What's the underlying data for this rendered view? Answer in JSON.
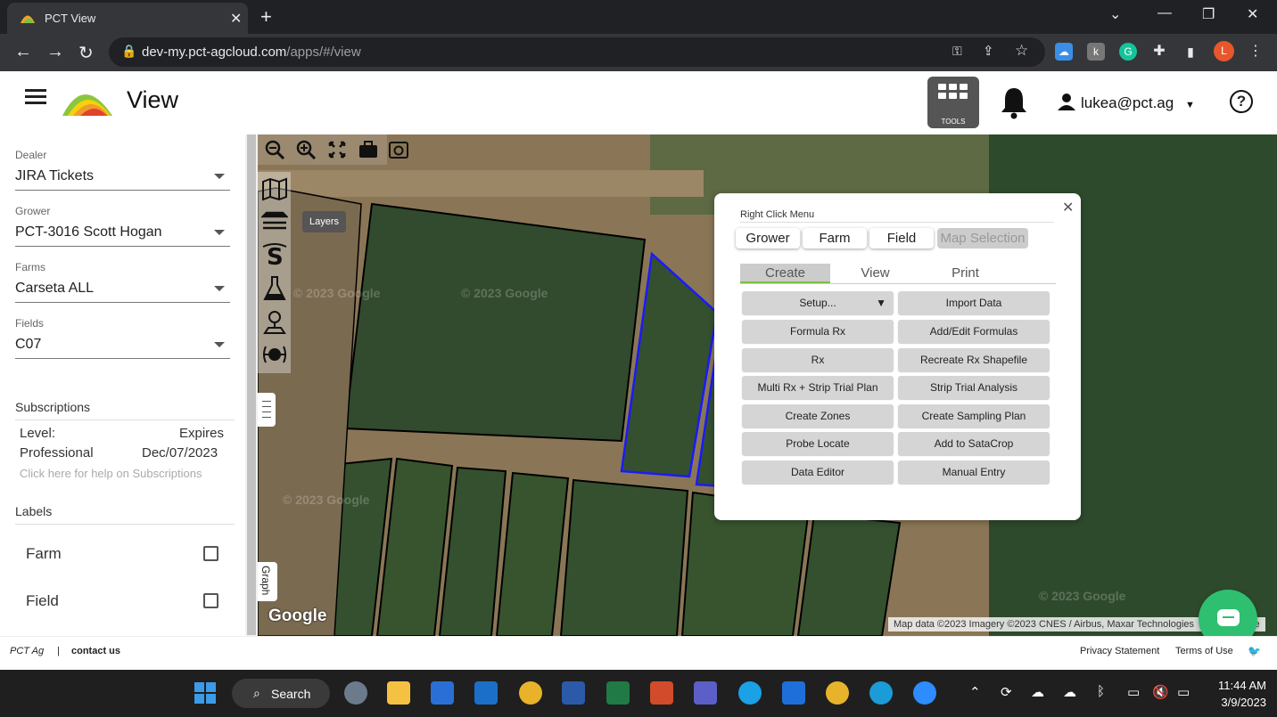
{
  "browser": {
    "tab_title": "PCT View",
    "url_host": "dev-my.pct-agcloud.com",
    "url_path": "/apps/#/view",
    "profile_initial": "L"
  },
  "header": {
    "title": "View",
    "tools_label": "TOOLS",
    "user_email": "lukea@pct.ag",
    "help_label": "?"
  },
  "sidebar": {
    "dealer": {
      "label": "Dealer",
      "value": "JIRA Tickets"
    },
    "grower": {
      "label": "Grower",
      "value": "PCT-3016 Scott Hogan"
    },
    "farms": {
      "label": "Farms",
      "value": "Carseta ALL"
    },
    "fields": {
      "label": "Fields",
      "value": "C07"
    },
    "subscriptions": {
      "heading": "Subscriptions",
      "level_label": "Level:",
      "expires_label": "Expires",
      "level_value": "Professional",
      "expires_value": "Dec/07/2023",
      "help_link": "Click here for help on Subscriptions"
    },
    "labels": {
      "heading": "Labels",
      "items": [
        {
          "label": "Farm",
          "checked": false
        },
        {
          "label": "Field",
          "checked": false
        }
      ]
    }
  },
  "map": {
    "layers_tooltip": "Layers",
    "graph_tab": "Graph",
    "google_logo": "Google",
    "watermark": "© 2023 Google",
    "attribution": "Map data ©2023 Imagery ©2023 CNES / Airbus, Maxar Technologies",
    "attribution_tail": "se"
  },
  "popup": {
    "title": "Right Click Menu",
    "scopes": [
      "Grower",
      "Farm",
      "Field",
      "Map Selection"
    ],
    "tabs": [
      "Create",
      "View",
      "Print"
    ],
    "active_tab": "Create",
    "actions_left": [
      "Setup...",
      "Formula Rx",
      "Rx",
      "Multi Rx + Strip Trial Plan",
      "Create Zones",
      "Probe Locate",
      "Data Editor"
    ],
    "actions_right": [
      "Import Data",
      "Add/Edit Formulas",
      "Recreate Rx Shapefile",
      "Strip Trial Analysis",
      "Create Sampling Plan",
      "Add to SataCrop",
      "Manual Entry"
    ],
    "setup_arrow": "▼"
  },
  "footer": {
    "brand": "PCT Ag",
    "separator": "|",
    "contact": "contact us",
    "privacy": "Privacy Statement",
    "terms": "Terms of Use"
  },
  "taskbar": {
    "search_label": "Search",
    "time": "11:44 AM",
    "date": "3/9/2023"
  },
  "colors": {
    "accent_green": "#7bc043",
    "chat_green": "#2fbf71",
    "field_outline_blue": "#1a1aff"
  }
}
